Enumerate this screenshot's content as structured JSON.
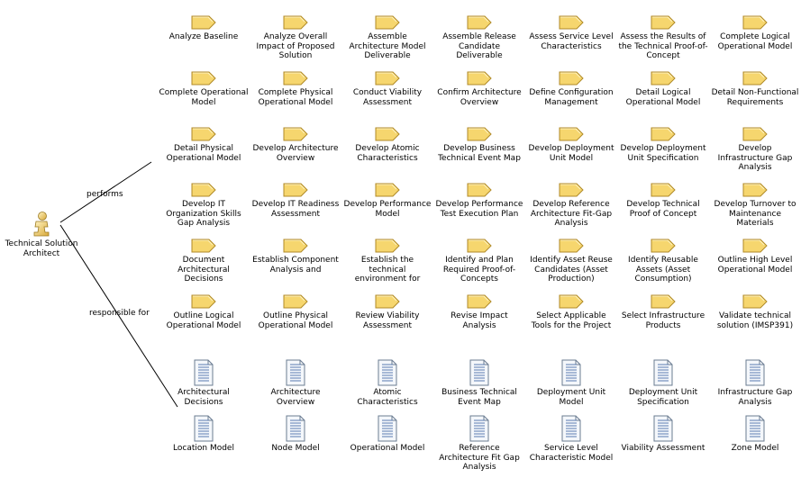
{
  "role": {
    "name": "Technical Solution Architect",
    "icon": "role-icon"
  },
  "relations": {
    "performs": "performs",
    "responsible_for": "responsible for"
  },
  "tasks": [
    "Analyze Baseline",
    "Analyze Overall Impact of Proposed Solution",
    "Assemble Architecture Model Deliverable",
    "Assemble Release Candidate Deliverable",
    "Assess Service Level Characteristics",
    "Assess the Results of the Technical Proof-of-Concept",
    "Complete Logical Operational Model",
    "Complete Operational Model",
    "Complete Physical Operational Model",
    "Conduct Viability Assessment",
    "Confirm Architecture Overview",
    "Define Configuration Management",
    "Detail Logical Operational Model",
    "Detail Non-Functional Requirements",
    "Detail Physical Operational Model",
    "Develop Architecture Overview",
    "Develop Atomic Characteristics",
    "Develop Business Technical Event Map",
    "Develop Deployment Unit Model",
    "Develop Deployment Unit Specification",
    "Develop Infrastructure Gap Analysis",
    "Develop IT Organization Skills Gap Analysis",
    "Develop IT Readiness Assessment",
    "Develop Performance Model",
    "Develop Performance Test Execution Plan",
    "Develop Reference Architecture Fit-Gap Analysis",
    "Develop Technical Proof of Concept",
    "Develop Turnover to Maintenance Materials",
    "Document Architectural Decisions",
    "Establish Component Analysis and",
    "Establish the technical environment for",
    "Identify and Plan Required Proof-of-Concepts",
    "Identify Asset Reuse Candidates (Asset Production)",
    "Identify Reusable Assets (Asset Consumption)",
    "Outline High Level Operational Model",
    "Outline Logical Operational Model",
    "Outline Physical Operational Model",
    "Review Viability Assessment",
    "Revise Impact Analysis",
    "Select Applicable Tools for the Project",
    "Select Infrastructure Products",
    "Validate technical solution (IMSP391)"
  ],
  "work_products": [
    "Architectural Decisions",
    "Architecture Overview",
    "Atomic Characteristics",
    "Business Technical Event Map",
    "Deployment Unit Model",
    "Deployment Unit Specification",
    "Infrastructure Gap Analysis",
    "Location Model",
    "Node Model",
    "Operational Model",
    "Reference Architecture Fit Gap Analysis",
    "Service Level Characteristic Model",
    "Viability Assessment",
    "Zone Model"
  ],
  "icons": {
    "task": "task-icon",
    "work_product": "document-icon"
  },
  "colors": {
    "task_fill": "#f6d66e",
    "task_stroke": "#b08a28",
    "doc_fill": "#f4f7fb",
    "doc_stroke": "#6b7c92",
    "doc_lines": "#5a7bb0",
    "line": "#000000"
  }
}
